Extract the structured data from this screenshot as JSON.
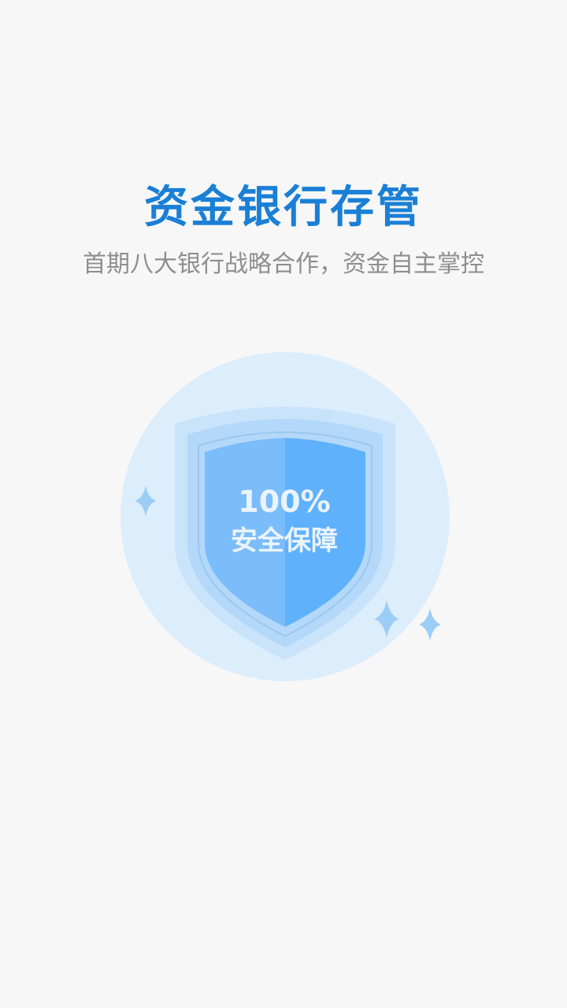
{
  "header": {
    "title": "资金银行存管",
    "subtitle": "首期八大银行战略合作，资金自主掌控"
  },
  "shield": {
    "percent": "100%",
    "label": "安全保障"
  },
  "colors": {
    "background": "#f7f7f7",
    "title": "#1a7fd6",
    "subtitle": "#8e8e8e",
    "circle": "#dcedfc",
    "shield_outer": "#c9e3fb",
    "shield_mid": "#b3d8f9",
    "shield_left": "#7bbcfb",
    "shield_right": "#5fb1fb",
    "sparkle": "#9ccdf6"
  }
}
